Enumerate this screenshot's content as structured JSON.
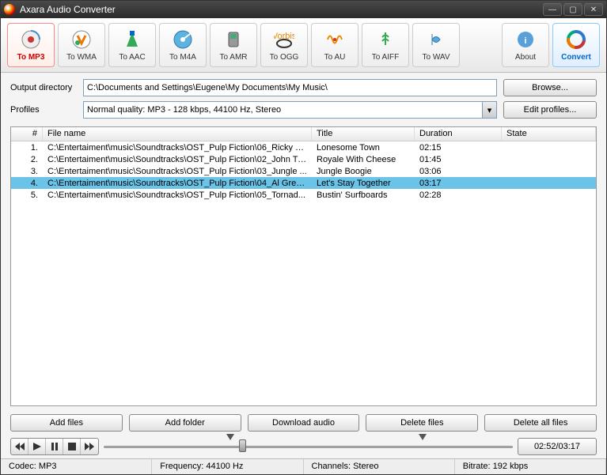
{
  "title": "Axara Audio Converter",
  "toolbar": {
    "format_buttons": [
      {
        "label": "To MP3",
        "active": true
      },
      {
        "label": "To WMA"
      },
      {
        "label": "To AAC"
      },
      {
        "label": "To M4A"
      },
      {
        "label": "To AMR"
      },
      {
        "label": "To OGG"
      },
      {
        "label": "To AU"
      },
      {
        "label": "To AIFF"
      },
      {
        "label": "To WAV"
      }
    ],
    "about": "About",
    "convert": "Convert"
  },
  "settings": {
    "output_label": "Output directory",
    "output_path": "C:\\Documents and Settings\\Eugene\\My Documents\\My Music\\",
    "browse": "Browse...",
    "profiles_label": "Profiles",
    "profile_value": "Normal quality: MP3 - 128 kbps, 44100 Hz, Stereo",
    "edit_profiles": "Edit profiles..."
  },
  "columns": {
    "n": "#",
    "fn": "File name",
    "tt": "Title",
    "du": "Duration",
    "st": "State"
  },
  "files": [
    {
      "n": "1.",
      "fn": "C:\\Entertaiment\\music\\Soundtracks\\OST_Pulp Fiction\\06_Ricky N...",
      "tt": "Lonesome Town",
      "du": "02:15",
      "st": ""
    },
    {
      "n": "2.",
      "fn": "C:\\Entertaiment\\music\\Soundtracks\\OST_Pulp Fiction\\02_John Tr...",
      "tt": "Royale With Cheese",
      "du": "01:45",
      "st": ""
    },
    {
      "n": "3.",
      "fn": "C:\\Entertaiment\\music\\Soundtracks\\OST_Pulp Fiction\\03_Jungle ...",
      "tt": "Jungle Boogie",
      "du": "03:06",
      "st": ""
    },
    {
      "n": "4.",
      "fn": "C:\\Entertaiment\\music\\Soundtracks\\OST_Pulp Fiction\\04_Al Gree...",
      "tt": "Let's Stay Together",
      "du": "03:17",
      "st": "",
      "selected": true
    },
    {
      "n": "5.",
      "fn": "C:\\Entertaiment\\music\\Soundtracks\\OST_Pulp Fiction\\05_Tornad...",
      "tt": "Bustin' Surfboards",
      "du": "02:28",
      "st": ""
    }
  ],
  "actions": {
    "add_files": "Add files",
    "add_folder": "Add folder",
    "download": "Download audio",
    "delete_files": "Delete files",
    "delete_all": "Delete all files"
  },
  "player": {
    "time": "02:52/03:17",
    "start_pct": 30,
    "end_pct": 77,
    "pos_pct": 33
  },
  "status": {
    "codec": "Codec: MP3",
    "freq": "Frequency: 44100 Hz",
    "ch": "Channels: Stereo",
    "br": "Bitrate: 192 kbps"
  }
}
